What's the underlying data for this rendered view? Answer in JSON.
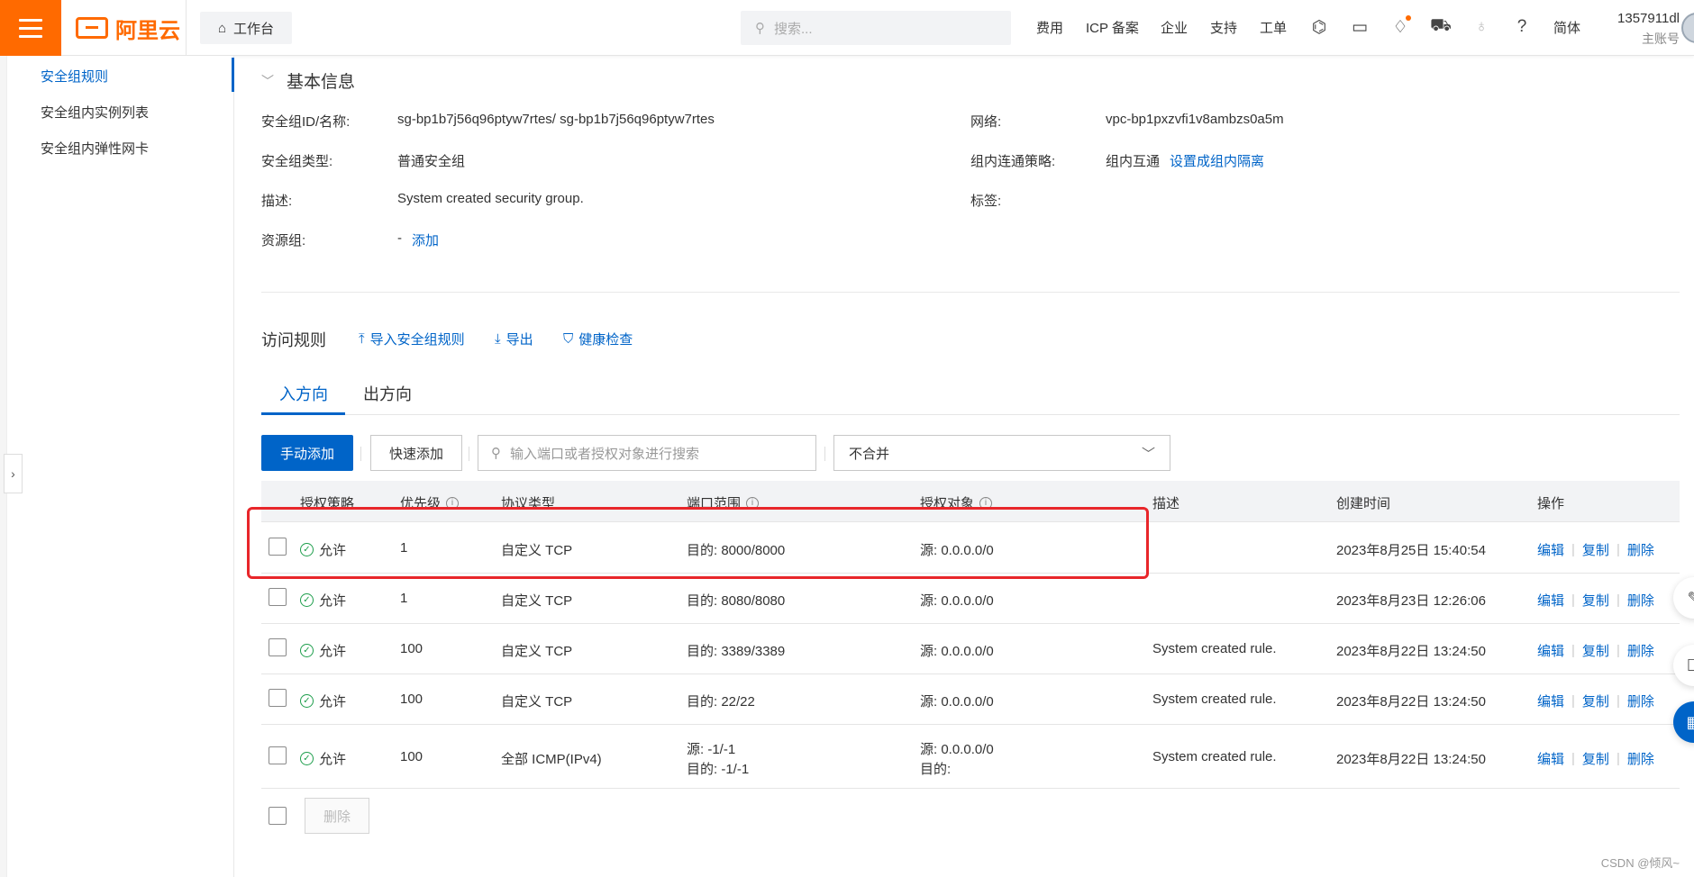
{
  "header": {
    "logo_text": "阿里云",
    "workbench_label": "工作台",
    "search_placeholder": "搜索...",
    "nav": [
      "费用",
      "ICP 备案",
      "企业",
      "支持",
      "工单"
    ],
    "lang": "简体",
    "account_name": "1357911dl",
    "account_sub": "主账号"
  },
  "sidebar": {
    "items": [
      "安全组规则",
      "安全组内实例列表",
      "安全组内弹性网卡"
    ]
  },
  "basic_info": {
    "title": "基本信息",
    "id_label": "安全组ID/名称:",
    "id_value": "sg-bp1b7j56q96ptyw7rtes/ sg-bp1b7j56q96ptyw7rtes",
    "type_label": "安全组类型:",
    "type_value": "普通安全组",
    "desc_label": "描述:",
    "desc_value": "System created security group.",
    "rg_label": "资源组:",
    "rg_dash": "-",
    "rg_add": "添加",
    "net_label": "网络:",
    "net_value": "vpc-bp1pxzvfi1v8ambzs0a5m",
    "policy_label": "组内连通策略:",
    "policy_value": "组内互通",
    "policy_link": "设置成组内隔离",
    "tag_label": "标签:"
  },
  "rules": {
    "title": "访问规则",
    "import_label": "导入安全组规则",
    "export_label": "导出",
    "health_label": "健康检查",
    "tabs": [
      "入方向",
      "出方向"
    ],
    "add_manual": "手动添加",
    "add_quick": "快速添加",
    "search_placeholder": "输入端口或者授权对象进行搜索",
    "merge_select": "不合并",
    "delete_label": "删除"
  },
  "table": {
    "headers": [
      "授权策略",
      "优先级",
      "协议类型",
      "端口范围",
      "授权对象",
      "描述",
      "创建时间",
      "操作"
    ],
    "ops": [
      "编辑",
      "复制",
      "删除"
    ],
    "rows": [
      {
        "policy": "允许",
        "priority": "1",
        "protocol": "自定义 TCP",
        "port": "目的: 8000/8000",
        "port2": "",
        "target": "源: 0.0.0.0/0",
        "target2": "",
        "desc": "",
        "time": "2023年8月25日 15:40:54"
      },
      {
        "policy": "允许",
        "priority": "1",
        "protocol": "自定义 TCP",
        "port": "目的: 8080/8080",
        "port2": "",
        "target": "源: 0.0.0.0/0",
        "target2": "",
        "desc": "",
        "time": "2023年8月23日 12:26:06"
      },
      {
        "policy": "允许",
        "priority": "100",
        "protocol": "自定义 TCP",
        "port": "目的: 3389/3389",
        "port2": "",
        "target": "源: 0.0.0.0/0",
        "target2": "",
        "desc": "System created rule.",
        "time": "2023年8月22日 13:24:50"
      },
      {
        "policy": "允许",
        "priority": "100",
        "protocol": "自定义 TCP",
        "port": "目的: 22/22",
        "port2": "",
        "target": "源: 0.0.0.0/0",
        "target2": "",
        "desc": "System created rule.",
        "time": "2023年8月22日 13:24:50"
      },
      {
        "policy": "允许",
        "priority": "100",
        "protocol": "全部 ICMP(IPv4)",
        "port": "源: -1/-1",
        "port2": "目的: -1/-1",
        "target": "源: 0.0.0.0/0",
        "target2": "目的:",
        "desc": "System created rule.",
        "time": "2023年8月22日 13:24:50"
      }
    ]
  },
  "watermark": "CSDN @倾风~"
}
